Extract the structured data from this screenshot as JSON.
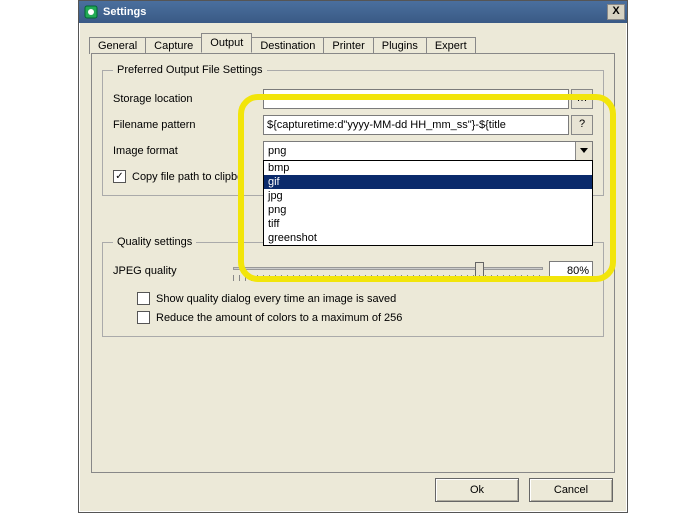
{
  "window": {
    "title": "Settings",
    "close_glyph": "X"
  },
  "tabs": {
    "general": "General",
    "capture": "Capture",
    "output": "Output",
    "destination": "Destination",
    "printer": "Printer",
    "plugins": "Plugins",
    "expert": "Expert"
  },
  "output": {
    "group1_legend": "Preferred Output File Settings",
    "storage_label": "Storage location",
    "storage_value": "",
    "filename_label": "Filename pattern",
    "filename_value": "${capturetime:d\"yyyy-MM-dd HH_mm_ss\"}-${title",
    "help_q": "?",
    "format_label": "Image format",
    "format_selected": "png",
    "format_options": [
      "bmp",
      "gif",
      "jpg",
      "png",
      "tiff",
      "greenshot"
    ],
    "format_selected_index": 1,
    "copy_clip_label": "Copy file path to clipboard every time an image is saved",
    "copy_clip_visible": "Copy file path to clipbo",
    "group2_legend": "Quality settings",
    "jpeg_label": "JPEG quality",
    "jpeg_value": "80%",
    "show_quality_label": "Show quality dialog every time an image is saved",
    "reduce_colors_label": "Reduce the amount of colors to a maximum of 256"
  },
  "buttons": {
    "ok": "Ok",
    "cancel": "Cancel"
  }
}
